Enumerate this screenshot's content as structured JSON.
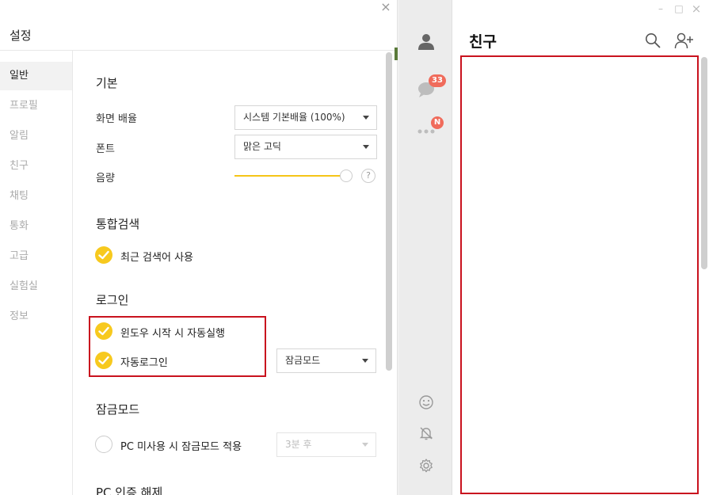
{
  "settings": {
    "title": "설정",
    "close_glyph": "×",
    "nav": [
      {
        "label": "일반"
      },
      {
        "label": "프로필"
      },
      {
        "label": "알림"
      },
      {
        "label": "친구"
      },
      {
        "label": "채팅"
      },
      {
        "label": "통화"
      },
      {
        "label": "고급"
      },
      {
        "label": "실험실"
      },
      {
        "label": "정보"
      }
    ],
    "basic": {
      "title": "기본",
      "zoom_label": "화면 배율",
      "zoom_value": "시스템 기본배율 (100%)",
      "font_label": "폰트",
      "font_value": "맑은 고딕",
      "volume_label": "음량",
      "volume_level_percent": 100,
      "help_glyph": "?"
    },
    "search": {
      "title": "통합검색",
      "recent_label": "최근 검색어 사용",
      "recent_checked": true
    },
    "login": {
      "title": "로그인",
      "autostart_label": "윈도우 시작 시 자동실행",
      "autostart_checked": true,
      "autologin_label": "자동로그인",
      "autologin_checked": true,
      "autologin_mode": "잠금모드"
    },
    "lock": {
      "title": "잠금모드",
      "idle_label": "PC 미사용 시 잠금모드 적용",
      "idle_checked": false,
      "idle_value": "3분 후"
    },
    "pc_auth": {
      "title": "PC 인증 해제"
    }
  },
  "messenger": {
    "chat_badge": "33",
    "more_badge": "N",
    "friends_title": "친구",
    "window": {
      "minimize": "–",
      "maximize": "□",
      "close": "×"
    }
  },
  "colors": {
    "accent_yellow": "#f7c91e",
    "badge_red": "#f06b5b",
    "highlight_red": "#c9121e"
  }
}
